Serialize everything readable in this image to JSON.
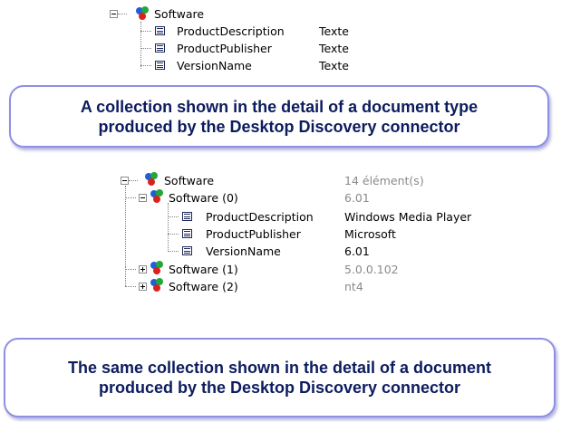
{
  "tree1": {
    "root": {
      "label": "Software"
    },
    "children": [
      {
        "label": "ProductDescription",
        "value": "Texte"
      },
      {
        "label": "ProductPublisher",
        "value": "Texte"
      },
      {
        "label": "VersionName",
        "value": "Texte"
      }
    ]
  },
  "caption1": {
    "line1": "A collection shown in the detail of a document type",
    "line2": "produced by the Desktop Discovery connector"
  },
  "tree2": {
    "root": {
      "label": "Software",
      "value": "14 élément(s)"
    },
    "item0": {
      "label": "Software (0)",
      "value": "6.01"
    },
    "item0_children": [
      {
        "label": "ProductDescription",
        "value": "Windows Media Player"
      },
      {
        "label": "ProductPublisher",
        "value": "Microsoft"
      },
      {
        "label": "VersionName",
        "value": "6.01"
      }
    ],
    "item1": {
      "label": "Software (1)",
      "value": "5.0.0.102"
    },
    "item2": {
      "label": "Software (2)",
      "value": "nt4"
    }
  },
  "caption2": {
    "line1": "The same collection shown in the detail of a document",
    "line2": "produced by the Desktop Discovery connector"
  },
  "icons": {
    "collection": "collection-icon",
    "field": "field-icon",
    "expand": "plus-expander-icon",
    "collapse": "minus-expander-icon"
  },
  "colors": {
    "caption_text": "#0c1c5e",
    "caption_border": "#8f8fe6",
    "value_gray": "#8a8a8a",
    "field_icon": "#1e2a5a"
  }
}
